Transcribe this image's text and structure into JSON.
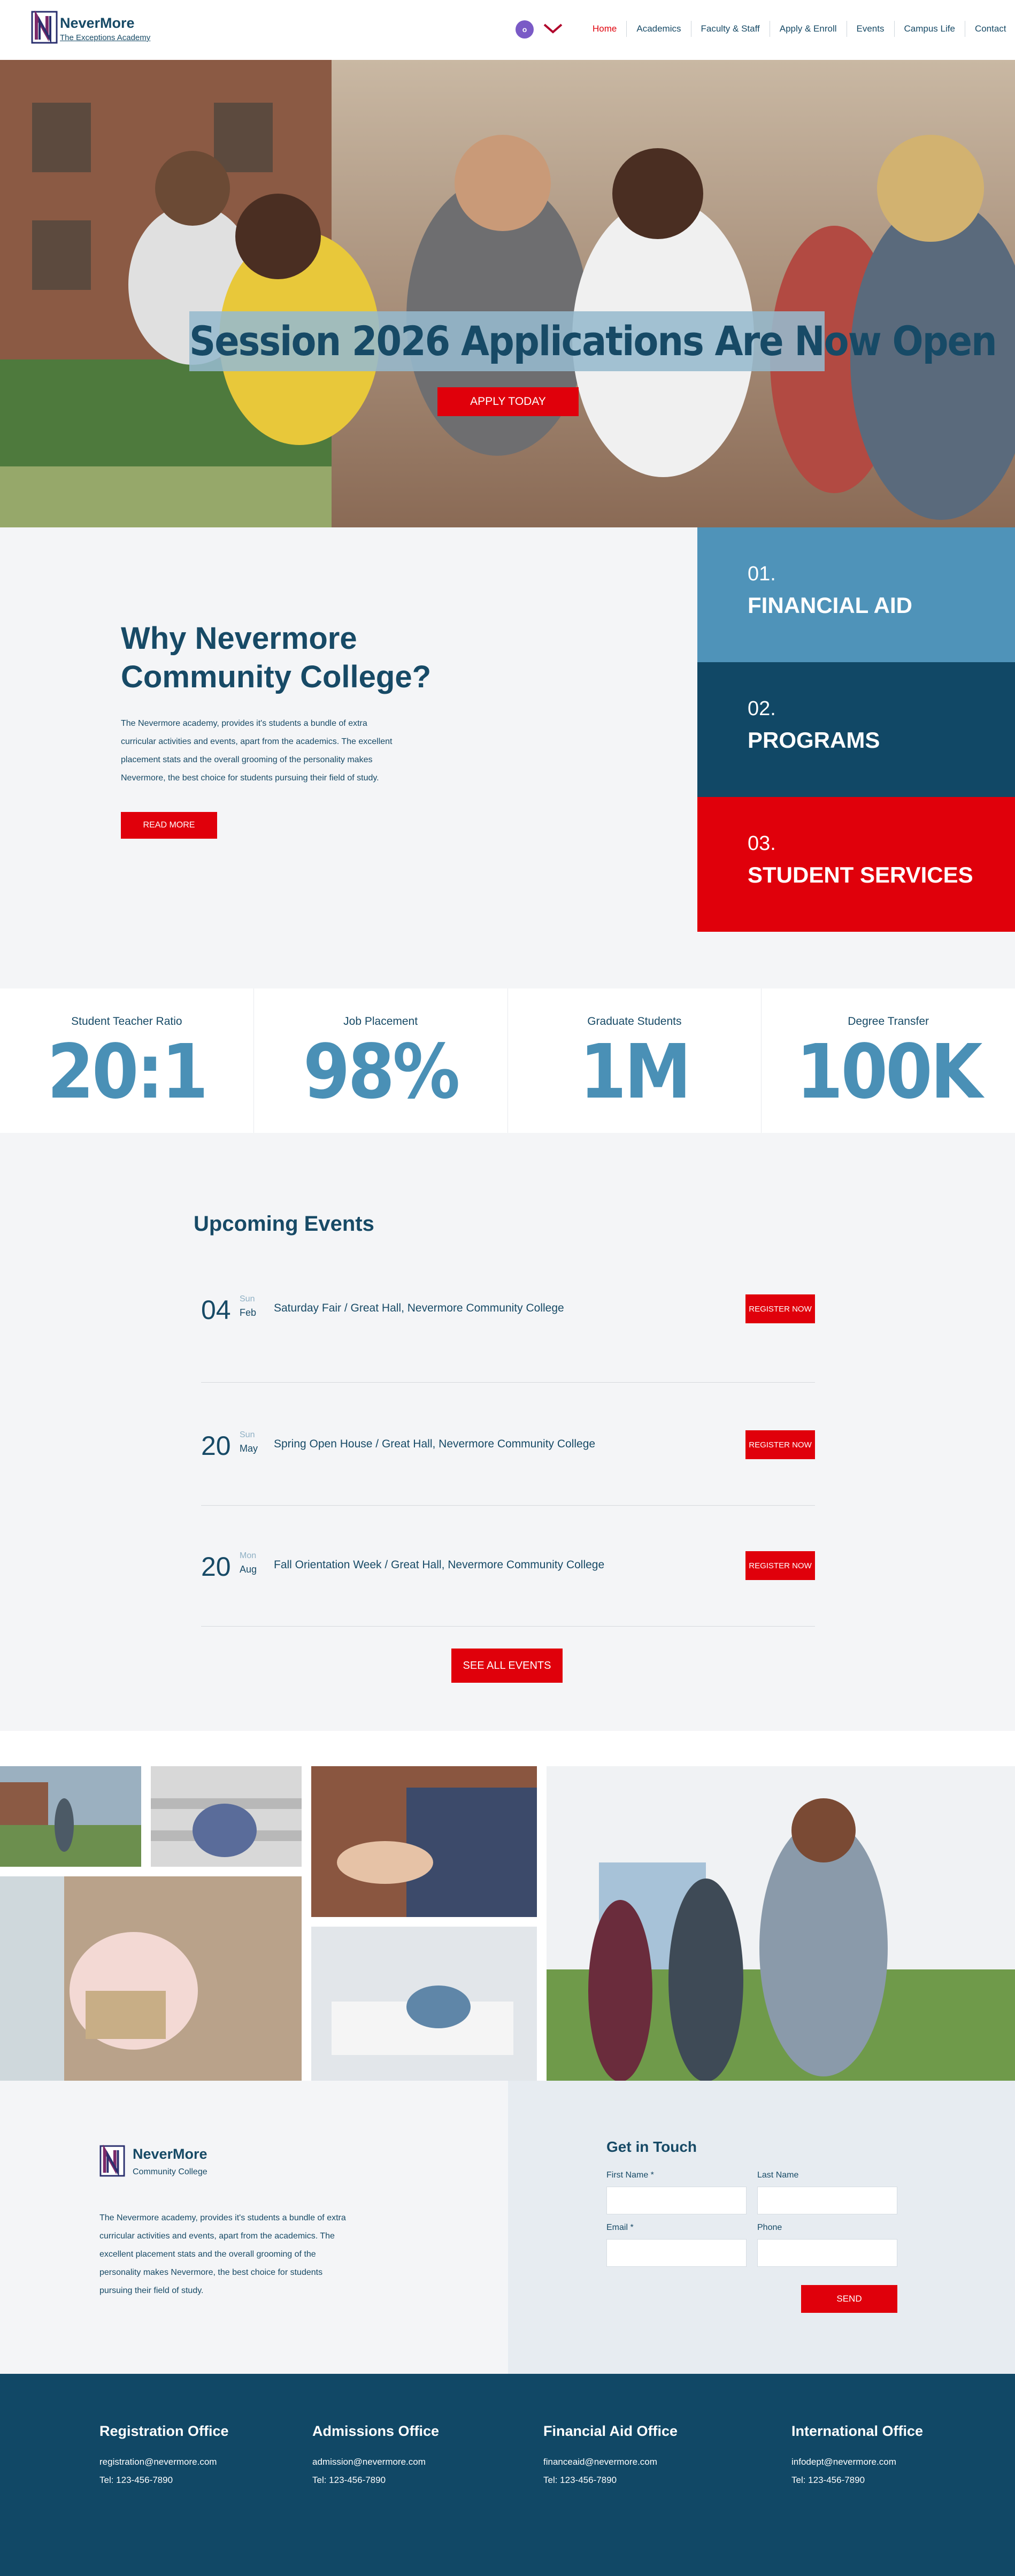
{
  "header": {
    "brand_name": "NeverMore",
    "brand_tagline": "The Exceptions Academy",
    "avatar_initial": "o",
    "nav": [
      "Home",
      "Academics",
      "Faculty & Staff",
      "Apply & Enroll",
      "Events",
      "Campus Life",
      "Contact"
    ]
  },
  "hero": {
    "title": "Session 2026 Applications Are Now Open",
    "button": "APPLY TODAY"
  },
  "why": {
    "title": "Why Nevermore Community College?",
    "text": "The Nevermore academy, provides it's students a bundle of extra curricular activities and events, apart from the academics. The excellent placement stats and the overall grooming of the personality makes Nevermore, the best choice for students pursuing their field of study.",
    "button": "READ MORE",
    "tiles": [
      {
        "num": "01.",
        "label": "FINANCIAL AID",
        "color": "#4f93b9"
      },
      {
        "num": "02.",
        "label": "PROGRAMS",
        "color": "#114866"
      },
      {
        "num": "03.",
        "label": "STUDENT SERVICES",
        "color": "#e0000b"
      }
    ]
  },
  "stats": [
    {
      "label": "Student Teacher Ratio",
      "value": "20:1"
    },
    {
      "label": "Job Placement",
      "value": "98%"
    },
    {
      "label": "Graduate Students",
      "value": "1M"
    },
    {
      "label": "Degree Transfer",
      "value": "100K"
    }
  ],
  "events": {
    "title": "Upcoming Events",
    "items": [
      {
        "day": "04",
        "weekday": "Sun",
        "month": "Feb",
        "desc": "Saturday Fair / Great Hall, Nevermore Community College",
        "button": "REGISTER NOW"
      },
      {
        "day": "20",
        "weekday": "Sun",
        "month": "May",
        "desc": "Spring Open House / Great Hall, Nevermore Community College",
        "button": "REGISTER NOW"
      },
      {
        "day": "20",
        "weekday": "Mon",
        "month": "Aug",
        "desc": "Fall Orientation Week / Great Hall, Nevermore Community College",
        "button": "REGISTER NOW"
      }
    ],
    "see_all": "SEE ALL EVENTS"
  },
  "footer": {
    "brand_name": "NeverMore",
    "brand_tagline": "Community College",
    "text": "The Nevermore academy, provides it's students a bundle of extra curricular activities and events, apart from the academics. The excellent placement stats and the overall grooming of the personality makes Nevermore, the best choice for students pursuing their field of study.",
    "contact": {
      "title": "Get in Touch",
      "first_name": "First Name *",
      "last_name": "Last Name",
      "email": "Email *",
      "phone": "Phone",
      "send": "SEND"
    },
    "offices": [
      {
        "title": "Registration Office",
        "email": "registration@nevermore.com",
        "tel": "Tel: 123-456-7890"
      },
      {
        "title": "Admissions Office",
        "email": "admission@nevermore.com",
        "tel": "Tel: 123-456-7890"
      },
      {
        "title": "Financial Aid Office",
        "email": "financeaid@nevermore.com",
        "tel": "Tel: 123-456-7890"
      },
      {
        "title": "International Office",
        "email": "infodept@nevermore.com",
        "tel": "Tel: 123-456-7890"
      }
    ]
  }
}
